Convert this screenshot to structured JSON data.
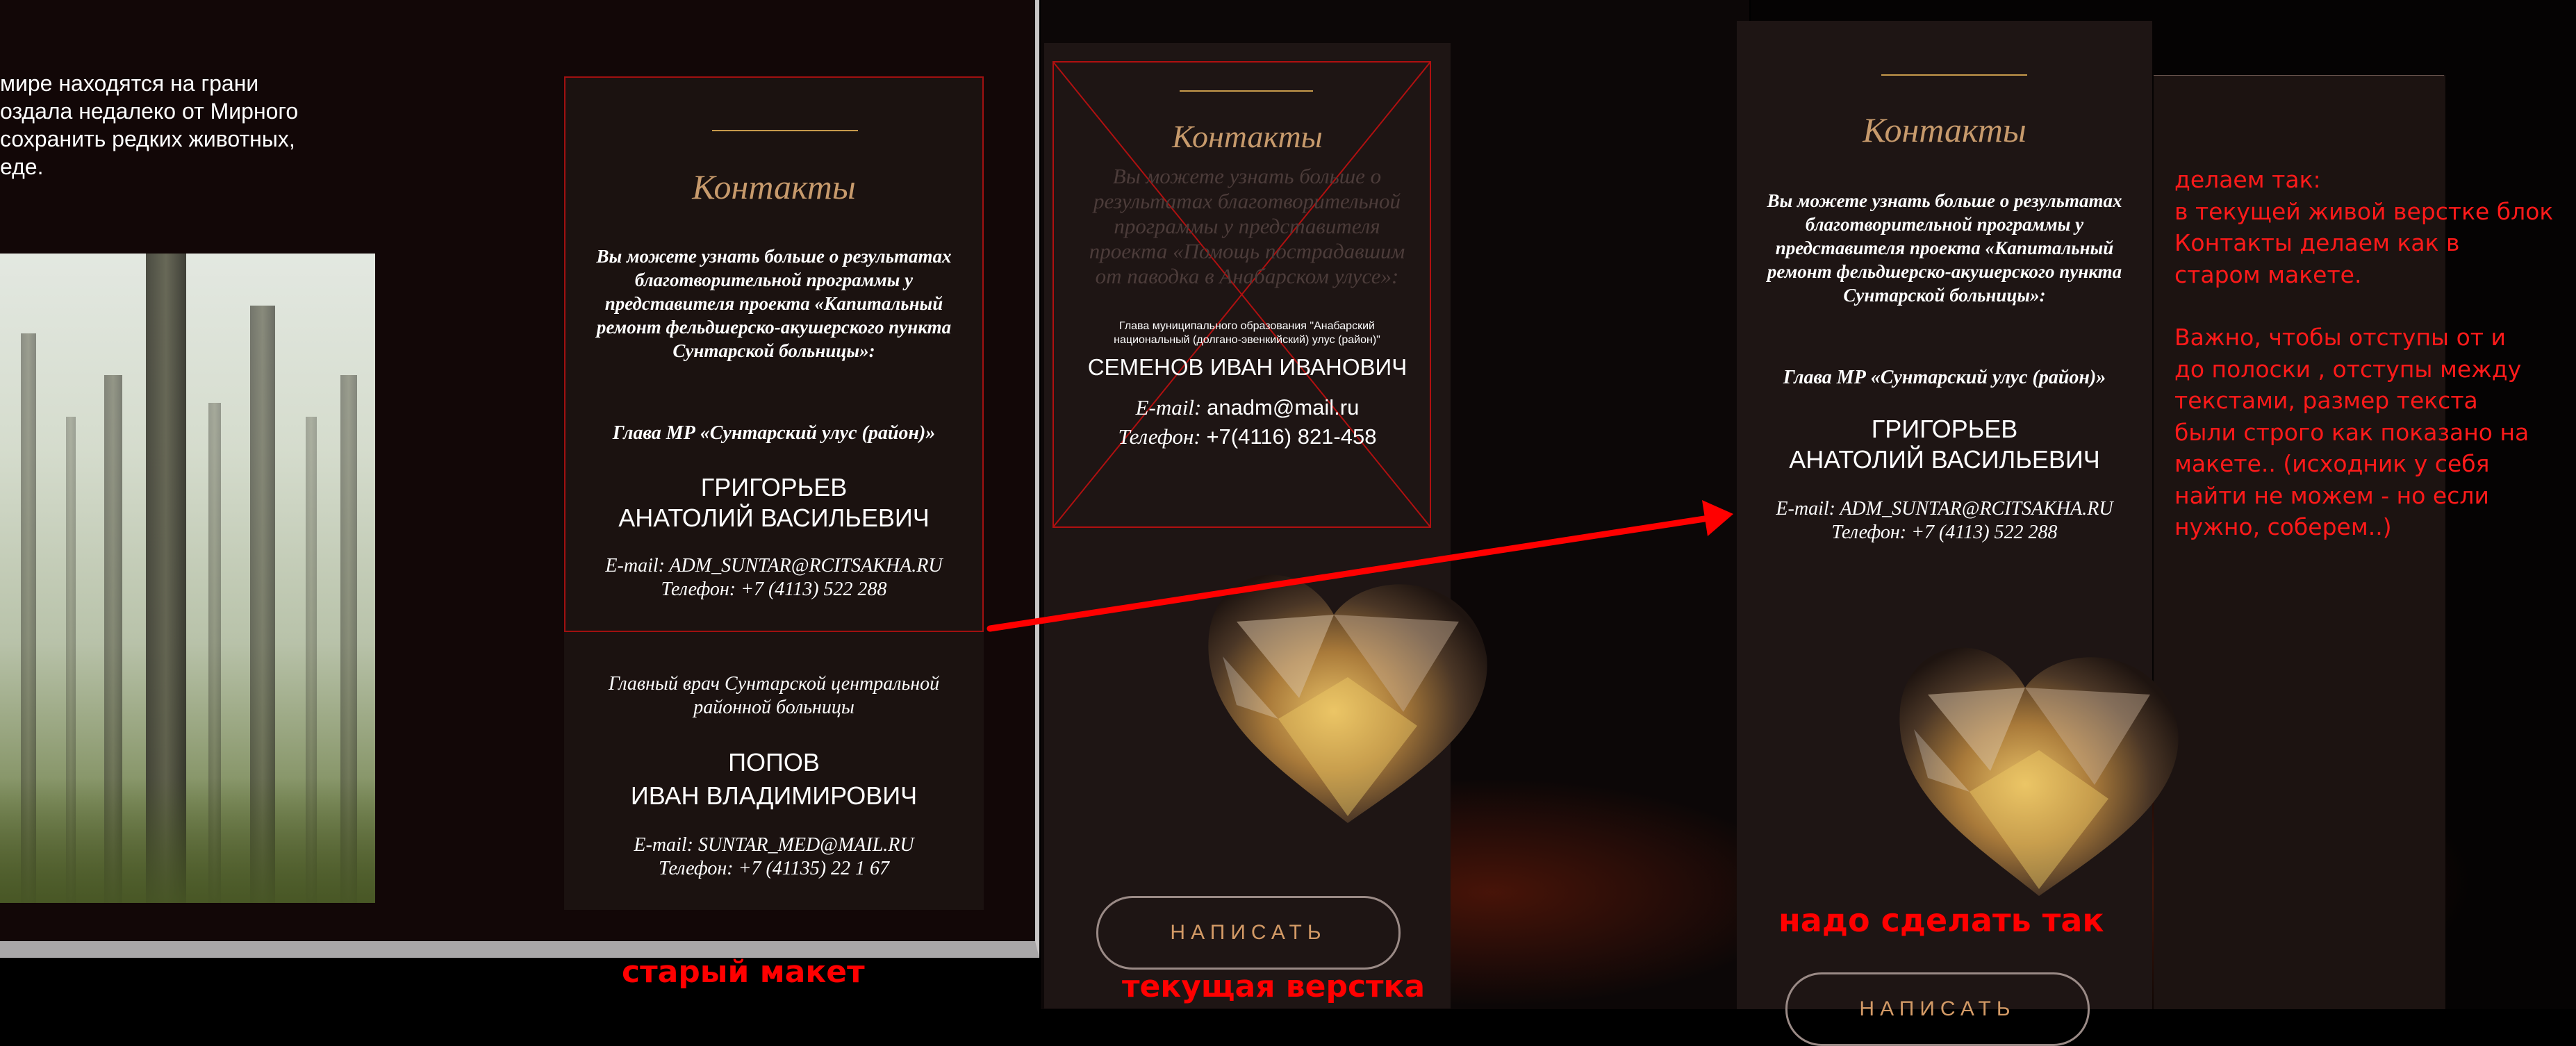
{
  "old_layout": {
    "intro_lines": [
      "мире находятся на грани",
      "оздала недалеко от Мирного",
      "сохранить редких животных,",
      "еде."
    ],
    "contacts": {
      "title": "Контакты",
      "description": "Вы можете узнать больше о результатах благотворительной программы у представителя проекта «Капитальный ремонт фельдшерско-акушерского пункта Сунтарской больницы»:",
      "person1_role": "Глава МР «Сунтарский улус (район)»",
      "person1_name_line1": "ГРИГОРЬЕВ",
      "person1_name_line2": "АНАТОЛИЙ ВАСИЛЬЕВИЧ",
      "person1_email": "E-mail: ADM_SUNTAR@RCITSAKHA.RU",
      "person1_phone": "Телефон: +7 (4113) 522 288",
      "person2_role": "Главный врач Сунтарской центральной районной больницы",
      "person2_name_line1": "ПОПОВ",
      "person2_name_line2": "ИВАН ВЛАДИМИРОВИЧ",
      "person2_email": "E-mail: SUNTAR_MED@MAIL.RU",
      "person2_phone": "Телефон: +7 (41135) 22 1 67"
    },
    "caption": "старый макет"
  },
  "current_layout": {
    "contacts": {
      "title": "Контакты",
      "description": "Вы можете узнать больше о результатах благотворительной программы у представителя проекта «Помощь пострадавшим от паводка в Анабарском улусе»:",
      "role_small": "Глава муниципального образования \"Анабарский национальный (долгано-эвенкийский) улус (район)\"",
      "name": "СЕМЕНОВ ИВАН ИВАНОВИЧ",
      "email_label": "E-mail:",
      "email_value": "anadm@mail.ru",
      "phone_label": "Телефон:",
      "phone_value": "+7(4116) 821-458"
    },
    "button_label": "НАПИСАТЬ",
    "caption": "текущая верстка"
  },
  "desired_layout": {
    "contacts": {
      "title": "Контакты",
      "description": "Вы можете узнать больше о результатах благотворительной программы у представителя проекта «Капитальный ремонт фельдшерско-акушерского пункта Сунтарской больницы»:",
      "role": "Глава МР «Сунтарский улус (район)»",
      "name_line1": "ГРИГОРЬЕВ",
      "name_line2": "АНАТОЛИЙ ВАСИЛЬЕВИЧ",
      "email": "E-mail: ADM_SUNTAR@RCITSAKHA.RU",
      "phone": "Телефон: +7 (4113) 522 288"
    },
    "button_label": "НАПИСАТЬ",
    "caption": "надо сделать так",
    "note_lines": [
      "делаем так:",
      "в текущей живой верстке блок",
      "Контакты делаем как в",
      "старом макете.",
      "",
      "Важно, чтобы отступы от и",
      "до  полоски , отступы между",
      "текстами, размер текста",
      "были строго как показано на",
      "макете.. (исходник у себя",
      "найти не можем - но если",
      "нужно, соберем..)"
    ]
  },
  "colors": {
    "accent_gold": "#c79a4c",
    "annotation_red": "#ff0000",
    "card_bg": "#1b1210"
  }
}
